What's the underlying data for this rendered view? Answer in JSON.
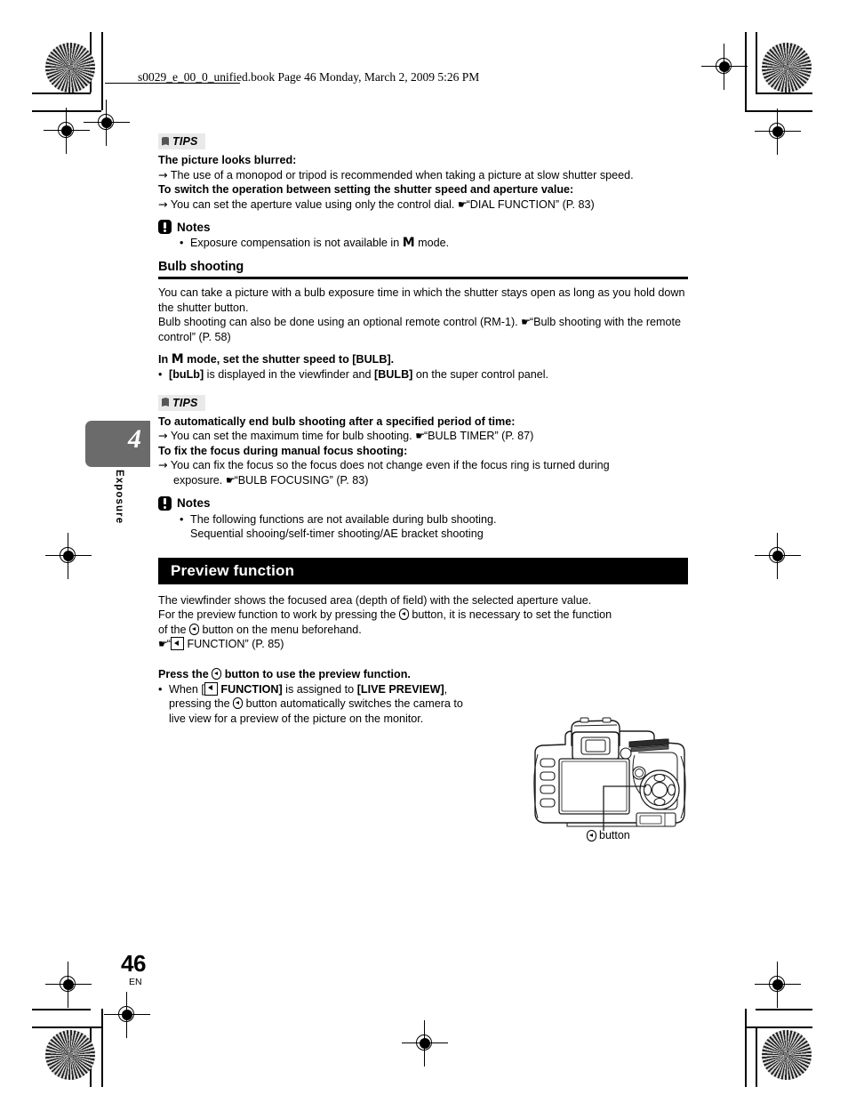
{
  "header": {
    "file_info": "s0029_e_00_0_unified.book  Page 46  Monday, March 2, 2009  5:26 PM"
  },
  "chapter": {
    "number": "4",
    "name": "Exposure"
  },
  "footer": {
    "page_number": "46",
    "language": "EN"
  },
  "tips1": {
    "badge": "TIPS",
    "heading1": "The picture looks blurred:",
    "line1": "The use of a monopod or tripod is recommended when taking a picture at slow shutter speed.",
    "heading2": "To switch the operation between setting the shutter speed and aperture value:",
    "line2_a": "You can set the aperture value using only the control dial.",
    "line2_ref": "“DIAL FUNCTION” (P. 83)"
  },
  "notes1": {
    "title": "Notes",
    "item1_a": "Exposure compensation is not available in",
    "item1_mode": "M",
    "item1_b": "mode."
  },
  "bulb": {
    "heading": "Bulb shooting",
    "para1": "You can take a picture with a bulb exposure time in which the shutter stays open as long as you hold down the shutter button.",
    "para2_a": "Bulb shooting can also be done using an optional remote control (RM-1).",
    "para2_ref": "“Bulb shooting with the remote control” (P. 58)",
    "instruction_a": "In",
    "instruction_mode": "M",
    "instruction_b": "mode, set the shutter speed to [BULB].",
    "bullet_a": "[buLb]",
    "bullet_b": "is displayed in the viewfinder and",
    "bullet_c": "[BULB]",
    "bullet_d": "on the super control panel."
  },
  "tips2": {
    "badge": "TIPS",
    "heading1": "To automatically end bulb shooting after a specified period of time:",
    "line1_a": "You can set the maximum time for bulb shooting.",
    "line1_ref": "“BULB TIMER” (P. 87)",
    "heading2": "To fix the focus during manual focus shooting:",
    "line2_a": "You can fix the focus so the focus does not change even if the focus ring is turned during",
    "line2_b": "exposure.",
    "line2_ref": "“BULB FOCUSING” (P. 83)"
  },
  "notes2": {
    "title": "Notes",
    "item1": "The following functions are not available during bulb shooting.",
    "item1_cont": "Sequential shooing/self-timer shooting/AE bracket shooting"
  },
  "preview": {
    "section_title": "Preview function",
    "para_line1": "The viewfinder shows the focused area (depth of field) with the selected aperture value.",
    "para_line2_a": "For the preview function to work by pressing the",
    "para_line2_b": "button, it is necessary to set the function",
    "para_line3_a": "of the",
    "para_line3_b": "button on the menu beforehand.",
    "ref_line": "FUNCTION” (P. 85)",
    "ref_quote_open": "“",
    "instruction_a": "Press the",
    "instruction_b": "button to use the preview function.",
    "bullet_a": "When [",
    "bullet_b": "FUNCTION]",
    "bullet_c": "is assigned to",
    "bullet_d": "[LIVE PREVIEW]",
    "bullet_e": ",",
    "bullet_line2_a": "pressing the",
    "bullet_line2_b": "button automatically switches the camera to",
    "bullet_line3": "live view for a preview of the picture on the monitor."
  },
  "figure": {
    "caption": "button",
    "alt": "camera-rear-illustration"
  },
  "colors": {
    "section_bar_bg": "#000000",
    "section_bar_text": "#ffffff",
    "tips_badge_bg": "#e9e9e9",
    "chapter_tab_bg": "#6b6b6b"
  }
}
